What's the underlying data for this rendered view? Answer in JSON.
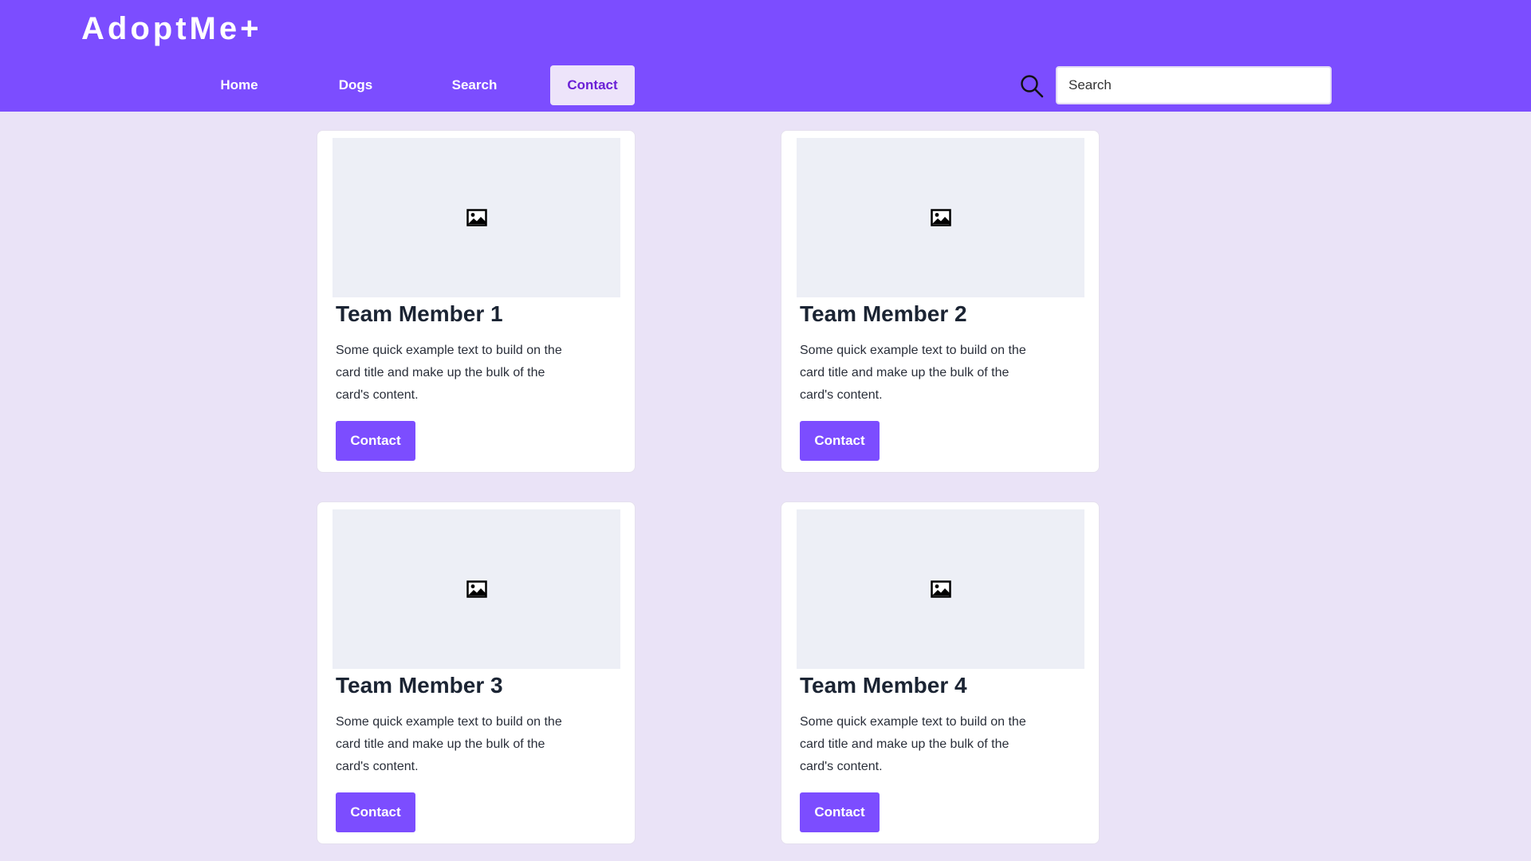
{
  "brand": "AdoptMe+",
  "nav": {
    "items": [
      {
        "label": "Home"
      },
      {
        "label": "Dogs"
      },
      {
        "label": "Search"
      },
      {
        "label": "Contact",
        "active": true
      }
    ]
  },
  "search": {
    "placeholder": "Search",
    "icon": "search-icon"
  },
  "cards": [
    {
      "title": "Team Member 1",
      "text": "Some quick example text to build on the card title and make up the bulk of the card's content.",
      "button": "Contact",
      "image_icon": "image-icon"
    },
    {
      "title": "Team Member 2",
      "text": "Some quick example text to build on the card title and make up the bulk of the card's content.",
      "button": "Contact",
      "image_icon": "image-icon"
    },
    {
      "title": "Team Member 3",
      "text": "Some quick example text to build on the card title and make up the bulk of the card's content.",
      "button": "Contact",
      "image_icon": "image-icon"
    },
    {
      "title": "Team Member 4",
      "text": "Some quick example text to build on the card title and make up the bulk of the card's content.",
      "button": "Contact",
      "image_icon": "image-icon"
    }
  ],
  "colors": {
    "header": "#7C4DFF",
    "background": "#EAE3F7",
    "button": "#7C4DFF",
    "active_nav_bg": "#EDE4FA",
    "active_nav_text": "#6A1FD6"
  }
}
